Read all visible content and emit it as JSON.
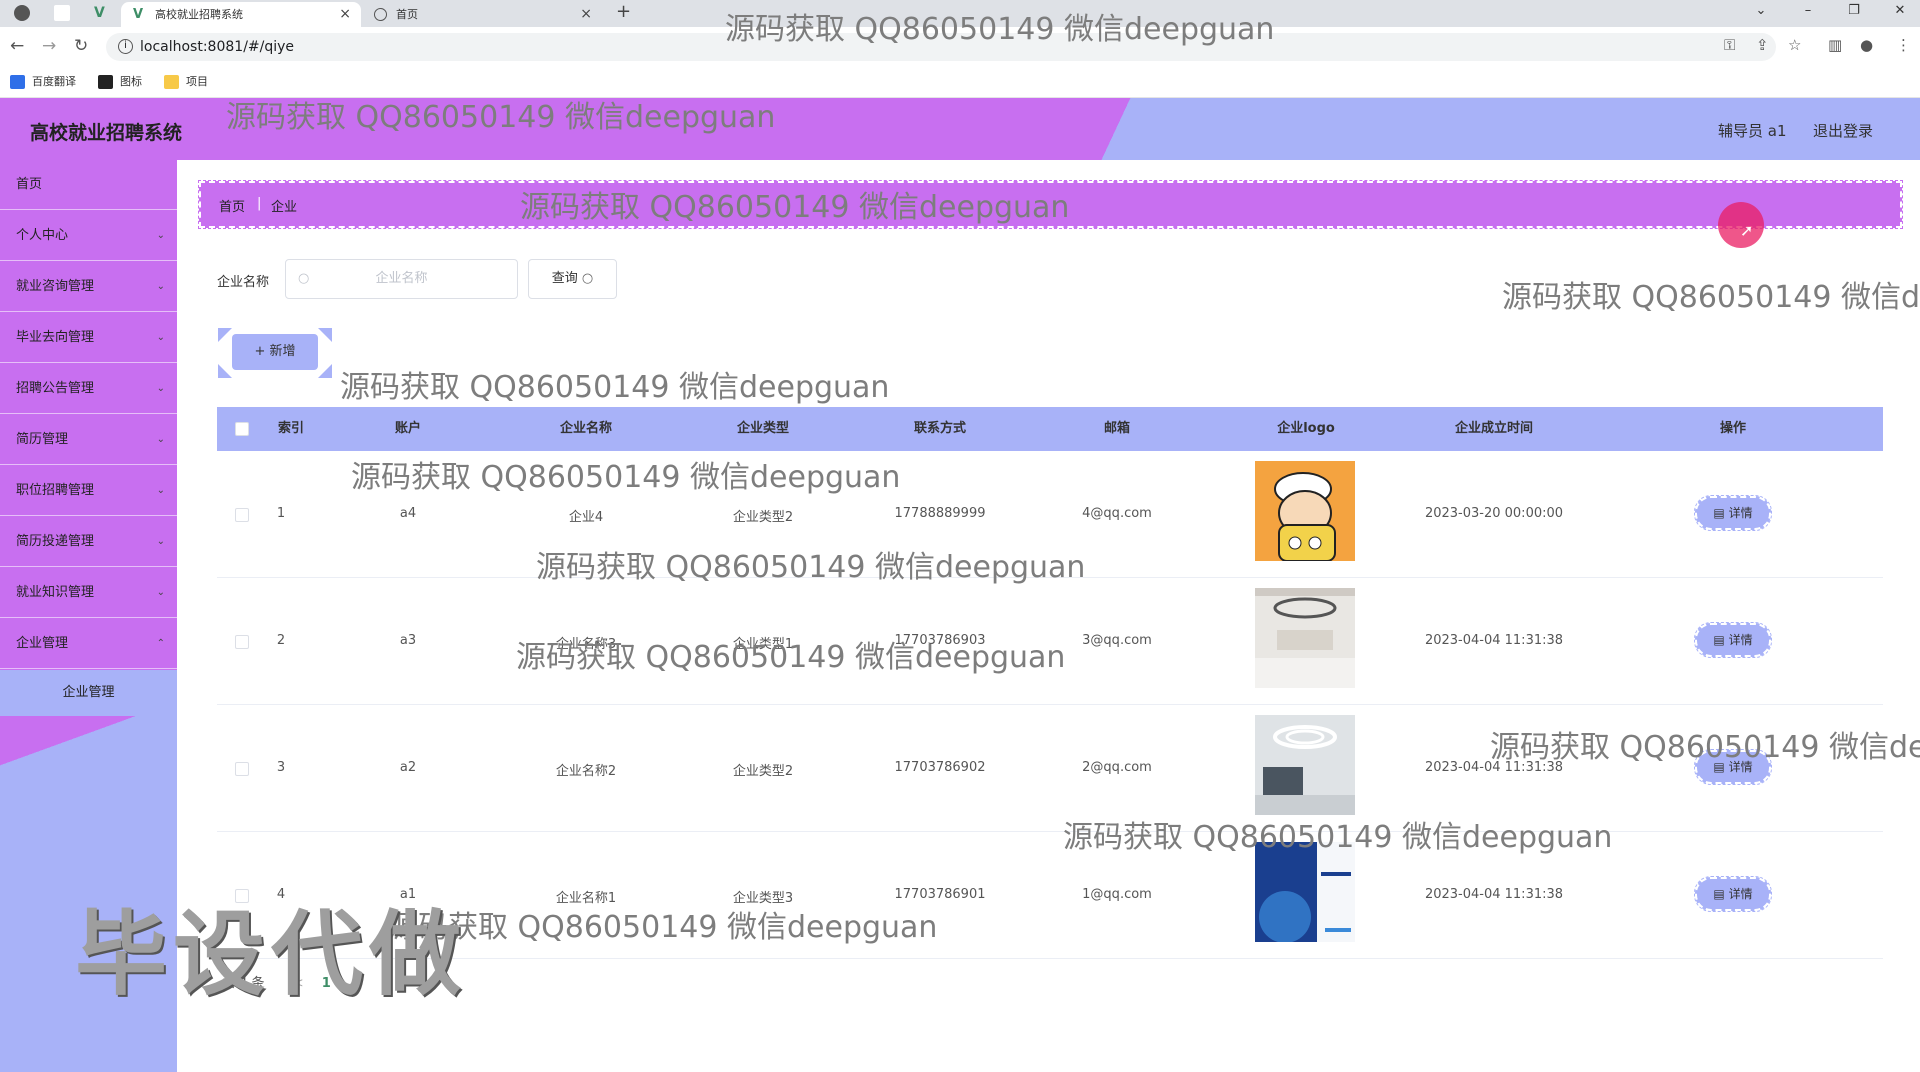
{
  "browser": {
    "tabs": [
      {
        "label": "高校就业招聘系统",
        "close": "×"
      },
      {
        "label": "首页",
        "close": "×"
      }
    ],
    "new_tab": "+",
    "url": "localhost:8081/#/qiye",
    "bookmarks": [
      "百度翻译",
      "图标",
      "项目"
    ]
  },
  "header": {
    "title": "高校就业招聘系统",
    "user": "辅导员 a1",
    "logout": "退出登录"
  },
  "sidebar": {
    "items": [
      {
        "label": "首页",
        "expandable": false
      },
      {
        "label": "个人中心",
        "expandable": true
      },
      {
        "label": "就业咨询管理",
        "expandable": true
      },
      {
        "label": "毕业去向管理",
        "expandable": true
      },
      {
        "label": "招聘公告管理",
        "expandable": true
      },
      {
        "label": "简历管理",
        "expandable": true
      },
      {
        "label": "职位招聘管理",
        "expandable": true
      },
      {
        "label": "简历投递管理",
        "expandable": true
      },
      {
        "label": "就业知识管理",
        "expandable": true
      },
      {
        "label": "企业管理",
        "expandable": true
      }
    ],
    "sub_item": "企业管理"
  },
  "breadcrumb": {
    "home": "首页",
    "sep": "|",
    "current": "企业"
  },
  "search": {
    "label": "企业名称",
    "placeholder": "企业名称",
    "button": "查询"
  },
  "add_button": "+ 新增",
  "table": {
    "columns": [
      "索引",
      "账户",
      "企业名称",
      "企业类型",
      "联系方式",
      "邮箱",
      "企业logo",
      "企业成立时间",
      "操作"
    ],
    "rows": [
      {
        "index": "1",
        "account": "a4",
        "name": "企业4",
        "type": "企业类型2",
        "phone": "17788889999",
        "email": "4@qq.com",
        "founded": "2023-03-20 00:00:00",
        "action": "详情"
      },
      {
        "index": "2",
        "account": "a3",
        "name": "企业名称3",
        "type": "企业类型1",
        "phone": "17703786903",
        "email": "3@qq.com",
        "founded": "2023-04-04 11:31:38",
        "action": "详情"
      },
      {
        "index": "3",
        "account": "a2",
        "name": "企业名称2",
        "type": "企业类型2",
        "phone": "17703786902",
        "email": "2@qq.com",
        "founded": "2023-04-04 11:31:38",
        "action": "详情"
      },
      {
        "index": "4",
        "account": "a1",
        "name": "企业名称1",
        "type": "企业类型3",
        "phone": "17703786901",
        "email": "1@qq.com",
        "founded": "2023-04-04 11:31:38",
        "action": "详情"
      }
    ]
  },
  "pagination": {
    "total": "共 4 条",
    "prev": "<",
    "page": "1"
  },
  "watermarks": [
    "源码获取 QQ86050149 微信deepguan",
    "毕设代做"
  ],
  "colors": {
    "purple": "#c86ff0",
    "lavender": "#a8b2f8"
  }
}
